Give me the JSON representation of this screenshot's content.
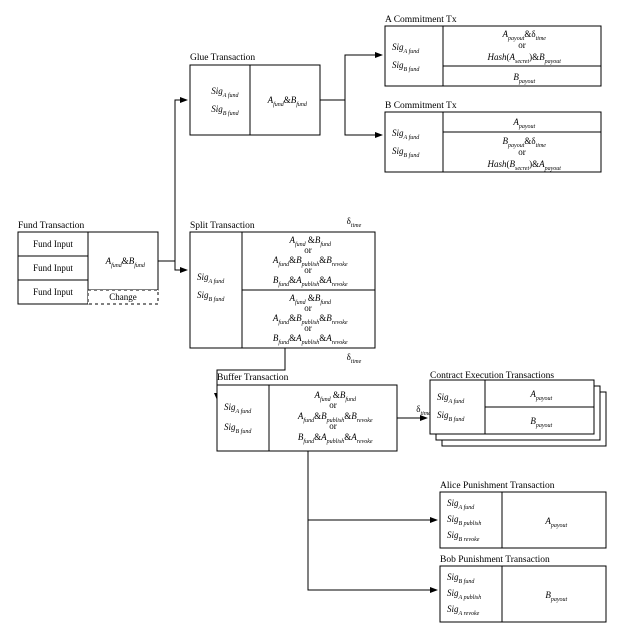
{
  "labels": {
    "fund_title": "Fund Transaction",
    "fund_in": "Fund Input",
    "change": "Change",
    "glue_title": "Glue Transaction",
    "split_title": "Split Transaction",
    "buffer_title": "Buffer Transaction",
    "a_commit_title": "A Commitment Tx",
    "b_commit_title": "B Commitment Tx",
    "cet_title": "Contract Execution Transactions",
    "alice_pun_title": "Alice Punishment Transaction",
    "bob_pun_title": "Bob Punishment Transaction",
    "sig_a_fund": "Sig",
    "sig_a_fund_sub": "A fund",
    "sig_b_fund": "Sig",
    "sig_b_fund_sub": "B fund",
    "sig_b_publish_sub": "B publish",
    "sig_a_publish_sub": "A publish",
    "sig_b_revoke_sub": "B revoke",
    "sig_a_revoke_sub": "A revoke",
    "a_fund_b_fund": "A",
    "or_text": "or",
    "a_payout": "A",
    "b_payout": "B",
    "delta_time": "δ",
    "delta_time_sub": "time",
    "amp": "&"
  },
  "texts": {
    "af_bf": "A_{fund} & B_{fund}",
    "af_bpub_brev": "A_{fund} & B_{publish} & B_{revoke}",
    "bf_apub_arev": "B_{fund} & A_{publish} & A_{revoke}",
    "apay_dtime": "A_{payout} & δ_{time}",
    "hash_asec_bpay": "Hash(A_{secret}) & B_{payout}",
    "bpay": "B_{payout}",
    "apay": "A_{payout}",
    "bpay_dtime": "B_{payout} & δ_{time}",
    "hash_bsec_apay": "Hash(B_{secret}) & A_{payout}",
    "cet_apay": "A_{payout}",
    "cet_bpay": "B_{payout}",
    "alice_out": "A_{payout}",
    "bob_out": "B_{payout}"
  }
}
